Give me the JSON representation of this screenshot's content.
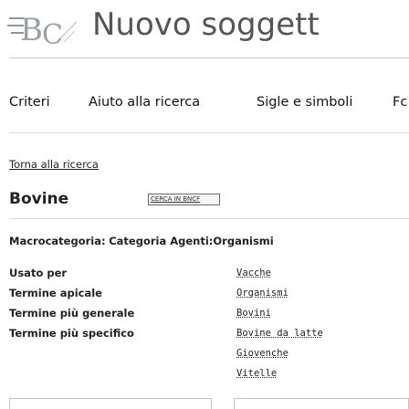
{
  "header": {
    "site_title": "Nuovo soggett",
    "logo_icon": "bncf-logo-icon"
  },
  "topnav": {
    "items": [
      {
        "label": "Criteri"
      },
      {
        "label": "Aiuto alla ricerca"
      },
      {
        "label": "Sigle e simboli"
      },
      {
        "label": "Fc"
      }
    ]
  },
  "back_link": "Torna alla ricerca",
  "term": {
    "title": "Bovine",
    "search_button": "CERCA IN BNCF"
  },
  "category": {
    "label": "Macrocategoria:",
    "value": "Categoria Agenti:Organismi"
  },
  "relations": [
    {
      "label": "Usato per",
      "value": "Vacche"
    },
    {
      "label": "Termine apicale",
      "value": "Organismi"
    },
    {
      "label": "Termine più generale",
      "value": "Bovini"
    },
    {
      "label": "Termine più specifico",
      "value": "Bovine da latte"
    },
    {
      "label": "",
      "value": "Giovenche"
    },
    {
      "label": "",
      "value": "Vitelle"
    }
  ],
  "colors": {
    "title_gray": "#555555",
    "logo_gray": "#9aa0a6",
    "rule": "#d9d9d9"
  }
}
